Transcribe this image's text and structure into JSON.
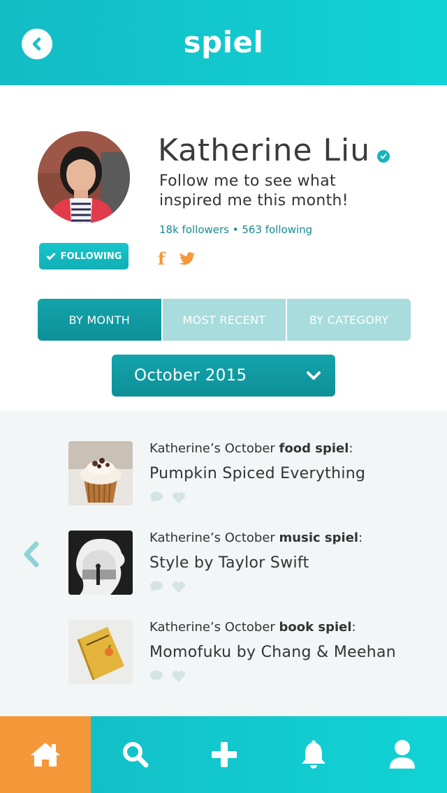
{
  "header": {
    "title": "spiel",
    "back_icon": "chevron-left-circle-icon"
  },
  "profile": {
    "name": "Katherine Liu",
    "verified_icon": "check-badge-icon",
    "bio": "Follow me to see what inspired me this month!",
    "stats": "18k followers • 563 following",
    "follow_button_label": "FOLLOWING",
    "socials": [
      {
        "icon": "facebook-icon",
        "glyph": "f"
      },
      {
        "icon": "twitter-icon"
      }
    ],
    "accent_color": "#f5983a"
  },
  "tabs": [
    {
      "label": "BY MONTH",
      "active": true
    },
    {
      "label": "MOST RECENT",
      "active": false
    },
    {
      "label": "BY CATEGORY",
      "active": false
    }
  ],
  "month_select": {
    "value": "October 2015"
  },
  "feed": {
    "items": [
      {
        "prefix": "Katherine’s October ",
        "category": "food spiel",
        "suffix": ":",
        "title": "Pumpkin Spiced Everything",
        "thumb": "cupcake"
      },
      {
        "prefix": "Katherine’s October ",
        "category": "music spiel",
        "suffix": ":",
        "title": "Style by Taylor Swift",
        "thumb": "silhouette"
      },
      {
        "prefix": "Katherine’s October ",
        "category": "book spiel",
        "suffix": ":",
        "title": "Momofuku by Chang & Meehan",
        "thumb": "book"
      }
    ]
  },
  "bottom_nav": [
    {
      "name": "home",
      "icon": "home-icon"
    },
    {
      "name": "search",
      "icon": "search-icon"
    },
    {
      "name": "add",
      "icon": "plus-icon"
    },
    {
      "name": "notifications",
      "icon": "bell-icon"
    },
    {
      "name": "profile",
      "icon": "user-icon"
    }
  ],
  "colors": {
    "header_gradient_start": "#13bcc4",
    "header_gradient_end": "#11d3d6",
    "primary_teal": "#11989f",
    "inactive_tab": "#a8dcdd",
    "home_active": "#f5983a",
    "feed_bg": "#f2f6f6"
  }
}
